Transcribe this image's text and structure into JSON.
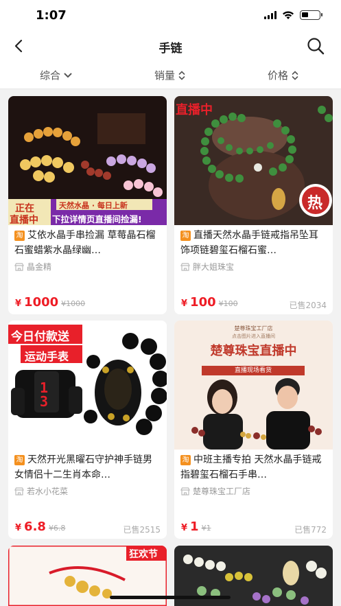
{
  "status": {
    "time": "1:07"
  },
  "nav": {
    "title": "手链"
  },
  "sort": {
    "items": [
      {
        "label": "综合"
      },
      {
        "label": "销量"
      },
      {
        "label": "价格"
      }
    ]
  },
  "products": [
    {
      "name": "艾依水晶手串捡漏 草莓晶石榴石蜜蜡紫水晶绿幽…",
      "shop": "晶金精",
      "price": "1000",
      "old": "¥1000",
      "sold": "",
      "img": {
        "badge1": "正在",
        "badge2": "直播中",
        "banner": "天然水晶 · 每日上新",
        "banner2": "下拉详情页直播间捡漏!"
      }
    },
    {
      "name": "直播天然水晶手链戒指吊坠耳饰项链碧玺石榴石蜜…",
      "shop": "胖大姐珠宝",
      "price": "100",
      "old": "¥100",
      "sold": "已售2034",
      "img": {
        "live": "直播中",
        "hot": "热"
      }
    },
    {
      "name": "天然开光黑曜石守护神手链男女情侣十二生肖本命…",
      "shop": "若水小花菜",
      "price": "6.8",
      "old": "¥6.8",
      "sold": "已售2515",
      "img": {
        "line1": "今日付款送",
        "line2": "运动手表",
        "watch": "13"
      }
    },
    {
      "name": "中班主播专拍 天然水晶手链戒指碧玺石榴石手串…",
      "shop": "楚尊珠宝工厂店",
      "price": "1",
      "old": "¥1",
      "sold": "已售772",
      "img": {
        "top": "楚尊珠宝工厂店",
        "sub": "点击图片进入直播间",
        "title": "楚尊珠宝直播中",
        "strip": "直播现场看货"
      }
    },
    {
      "name": "",
      "shop": "",
      "price": "",
      "old": "",
      "sold": "",
      "img": {
        "tag": "狂欢节"
      }
    },
    {
      "name": "",
      "shop": "",
      "price": "",
      "old": "",
      "sold": "",
      "img": {}
    }
  ],
  "currency": "¥",
  "platform_badge": "淘",
  "colors": {
    "price": "#ee1c25",
    "badge": "#f4901e",
    "live_red": "#e8202a"
  }
}
